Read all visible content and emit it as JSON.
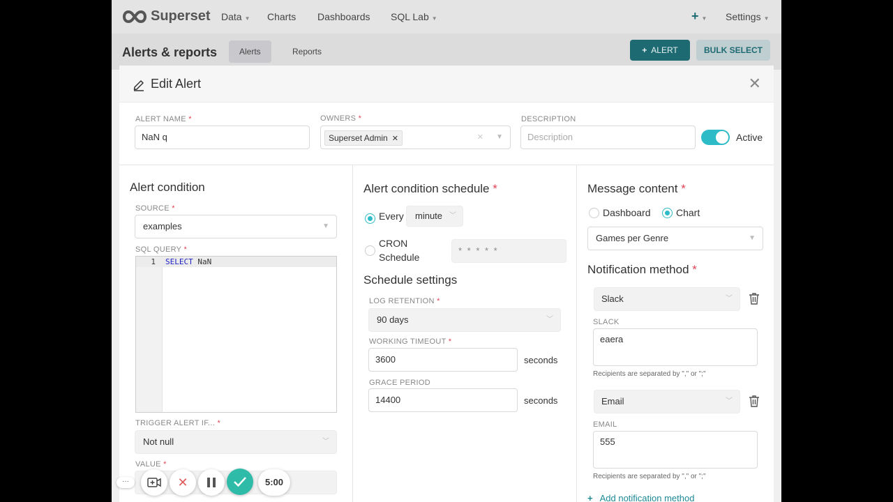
{
  "nav": {
    "brand": "Superset",
    "items": [
      {
        "label": "Data",
        "has_caret": true
      },
      {
        "label": "Charts",
        "has_caret": false
      },
      {
        "label": "Dashboards",
        "has_caret": false
      },
      {
        "label": "SQL Lab",
        "has_caret": true
      }
    ],
    "plus_icon": "plus-icon",
    "settings_label": "Settings"
  },
  "subheader": {
    "title": "Alerts & reports",
    "tabs": [
      "Alerts",
      "Reports"
    ],
    "active_tab": "Alerts",
    "alert_button": "ALERT",
    "bulk_select_button": "BULK SELECT"
  },
  "modal": {
    "title": "Edit Alert",
    "alert_name": {
      "label": "ALERT NAME",
      "value": "NaN q"
    },
    "owners": {
      "label": "OWNERS",
      "tag": "Superset Admin"
    },
    "description": {
      "label": "DESCRIPTION",
      "placeholder": "Description"
    },
    "active_label": "Active",
    "active": true,
    "alert_condition": {
      "title": "Alert condition",
      "source_label": "SOURCE",
      "source_value": "examples",
      "sql_label": "SQL QUERY",
      "line_number": "1",
      "sql_keyword": "SELECT",
      "sql_rest": " NaN",
      "trigger_label": "TRIGGER ALERT IF...",
      "trigger_value": "Not null",
      "value_label": "VALUE"
    },
    "schedule": {
      "title": "Alert condition schedule",
      "every_label": "Every",
      "every_value": "minute",
      "cron_label_1": "CRON",
      "cron_label_2": "Schedule",
      "cron_value": "* * * * *",
      "settings_title": "Schedule settings",
      "log_retention_label": "LOG RETENTION",
      "log_retention_value": "90 days",
      "working_timeout_label": "WORKING TIMEOUT",
      "working_timeout_value": "3600",
      "grace_period_label": "GRACE PERIOD",
      "grace_period_value": "14400",
      "seconds": "seconds"
    },
    "message": {
      "title": "Message content",
      "option_dashboard": "Dashboard",
      "option_chart": "Chart",
      "selected": "Chart",
      "chart_value": "Games per Genre",
      "notification_title": "Notification method",
      "methods": [
        {
          "type": "Slack",
          "field_label": "SLACK",
          "value": "eaera",
          "note": "Recipients are separated by \",\" or \";\""
        },
        {
          "type": "Email",
          "field_label": "EMAIL",
          "value": "555",
          "note": "Recipients are separated by \",\" or \";\""
        }
      ],
      "add_method": "Add notification method"
    }
  },
  "recorder": {
    "more": "···",
    "timer": "5:00"
  },
  "colors": {
    "primary": "#1e6a73",
    "accent": "#2ebbc8",
    "required": "#e04355"
  }
}
